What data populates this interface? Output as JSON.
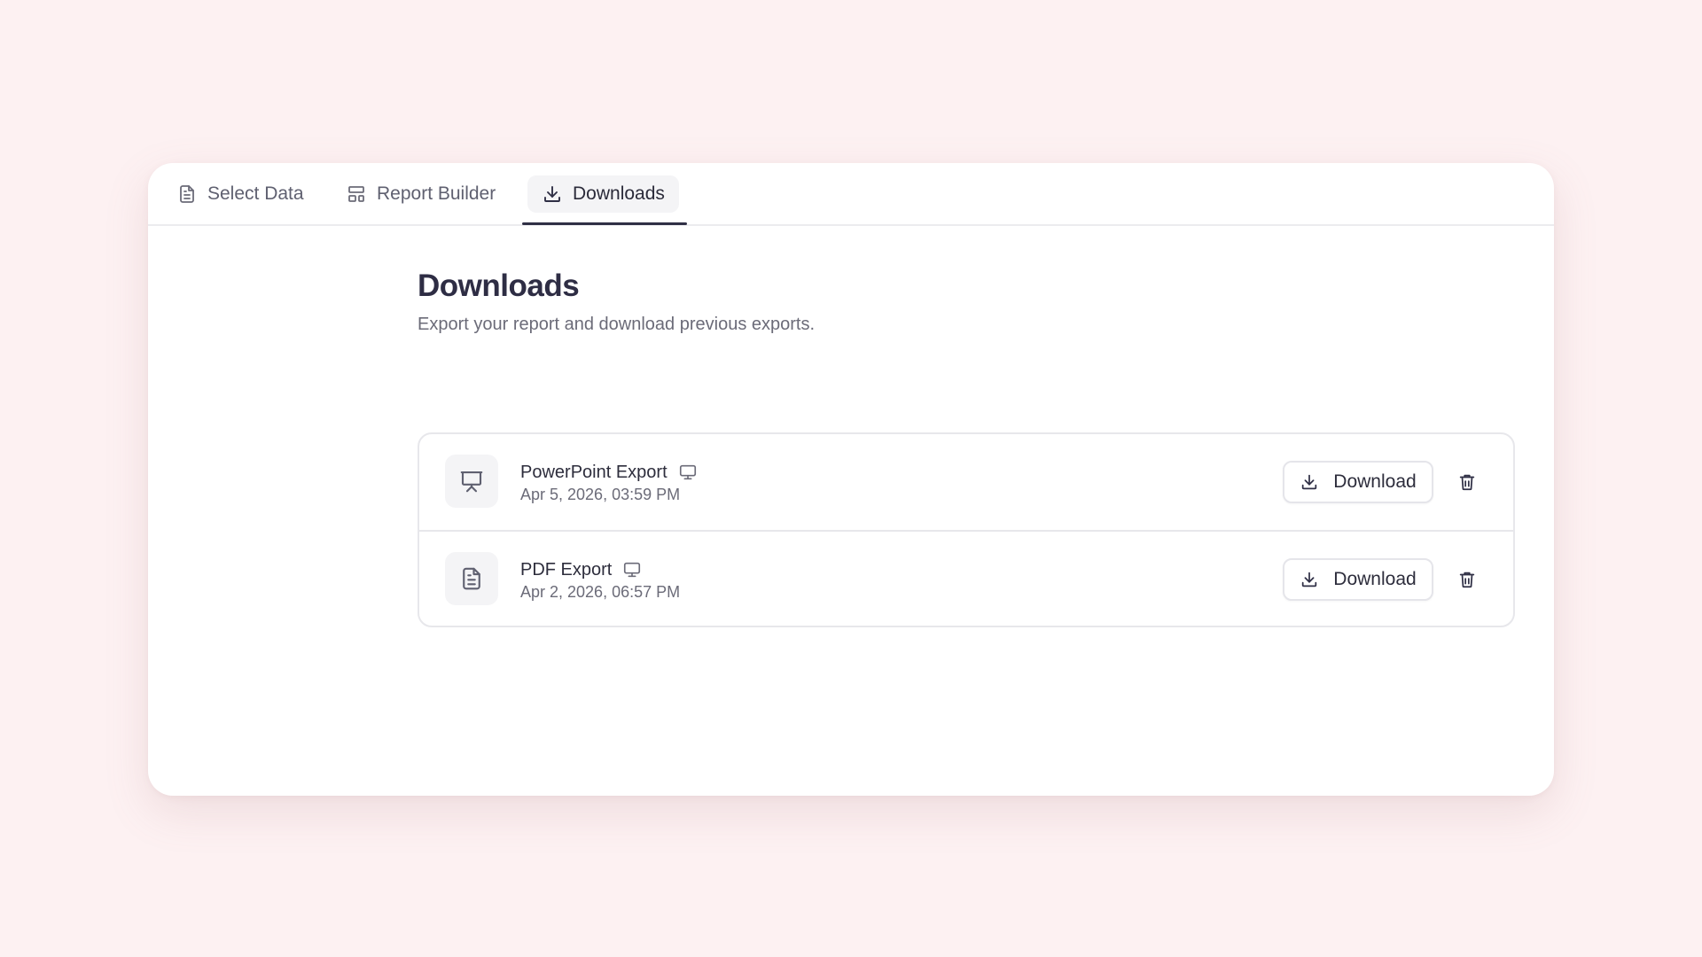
{
  "colors": {
    "page_background": "#fdf1f2",
    "card_background": "#ffffff",
    "active_tab_indicator": "#2f2f45",
    "text_primary": "#2d2d3c",
    "text_secondary": "#6b6b78"
  },
  "tabs": [
    {
      "label": "Select Data",
      "icon": "file-text-icon",
      "active": false
    },
    {
      "label": "Report Builder",
      "icon": "layout-icon",
      "active": false
    },
    {
      "label": "Downloads",
      "icon": "download-icon",
      "active": true
    }
  ],
  "main": {
    "title": "Downloads",
    "subtitle": "Export your report and download previous exports."
  },
  "exports": [
    {
      "name": "PowerPoint Export",
      "type_icon": "presentation-icon",
      "source_icon": "monitor-icon",
      "date": "Apr 5, 2026, 03:59 PM",
      "download_label": "Download",
      "delete_icon": "trash-icon"
    },
    {
      "name": "PDF Export",
      "type_icon": "document-icon",
      "source_icon": "monitor-icon",
      "date": "Apr 2, 2026, 06:57 PM",
      "download_label": "Download",
      "delete_icon": "trash-icon"
    }
  ]
}
